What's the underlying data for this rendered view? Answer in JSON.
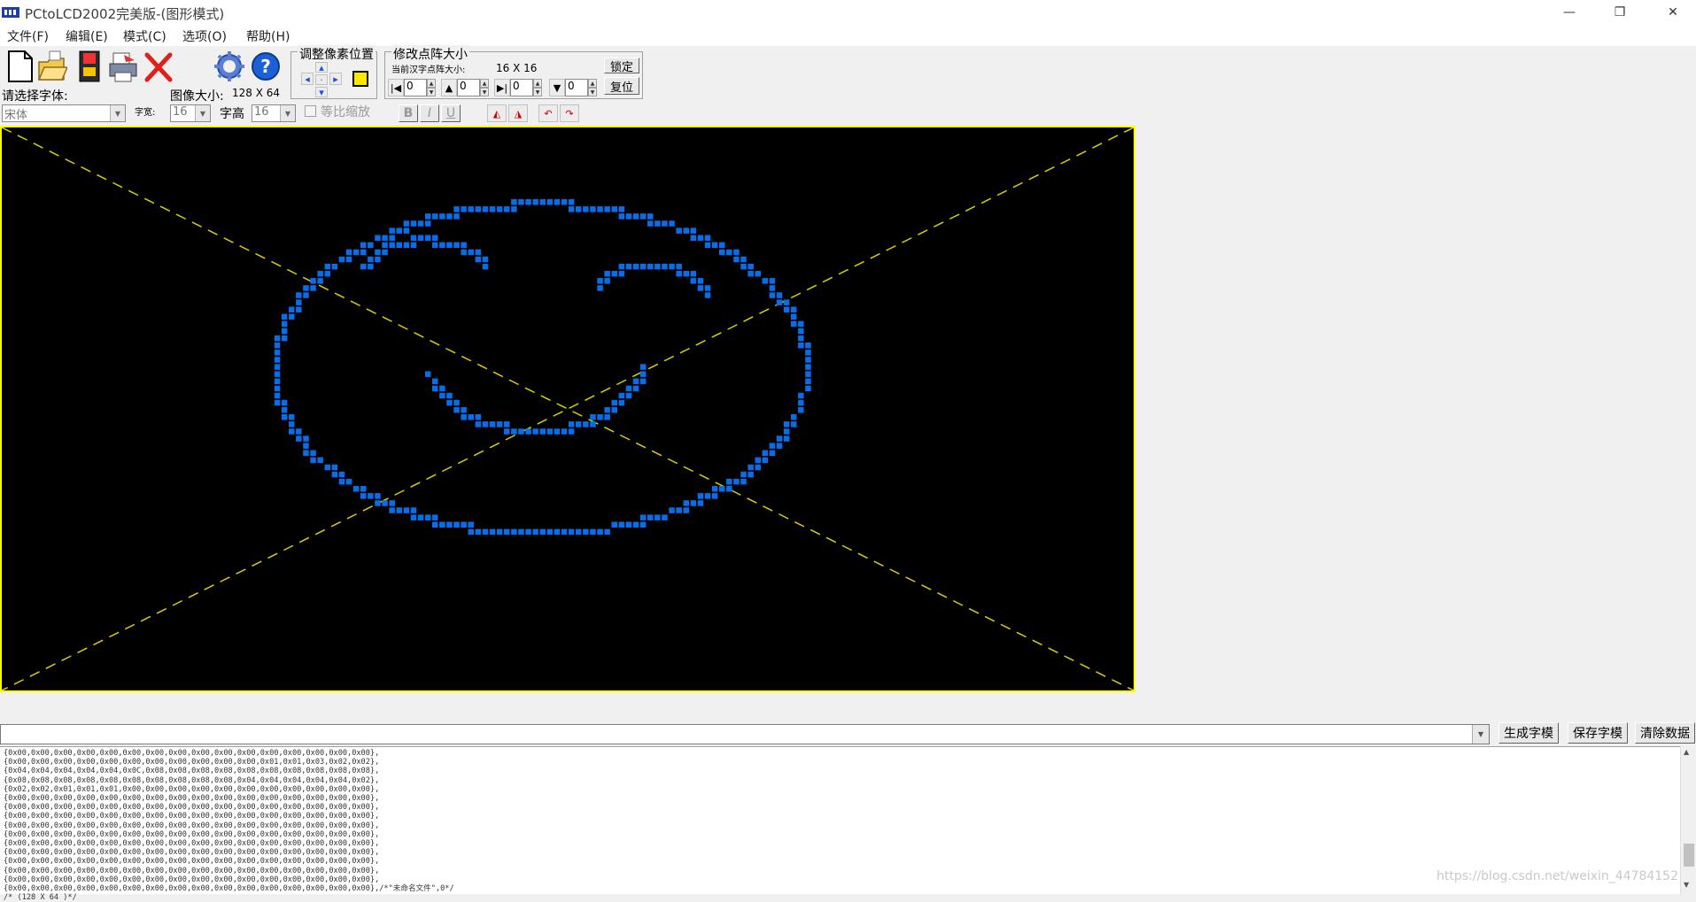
{
  "window": {
    "title": "PCtoLCD2002完美版-(图形模式)",
    "controls": [
      "—",
      "❐",
      "✕"
    ]
  },
  "menu": [
    "文件(F)",
    "编辑(E)",
    "模式(C)",
    "选项(O)",
    "帮助(H)"
  ],
  "toolbar": {
    "font_select_label": "请选择字体:",
    "font_value": "宋体",
    "char_width_label": "字宽:",
    "char_width_value": "16",
    "image_size_label": "图像大小:",
    "image_size_value": "128 X 64",
    "char_height_label": "字高",
    "char_height_value": "16",
    "proportional_label": "等比缩放",
    "style_buttons": [
      "B",
      "I",
      "U"
    ],
    "adjust_pixel_label": "调整像素位置",
    "modify_matrix_label": "修改点阵大小",
    "current_matrix_label": "当前汉字点阵大小:",
    "current_matrix_value": "16 X 16",
    "spin_values": [
      "0",
      "0",
      "0",
      "0"
    ],
    "lock_label": "锁定",
    "reset_label": "复位"
  },
  "bottom": {
    "input_value": "",
    "generate_label": "生成字模",
    "save_label": "保存字模",
    "clear_label": "清除数据"
  },
  "output_lines": [
    "{0x00,0x00,0x00,0x00,0x00,0x00,0x00,0x00,0x00,0x00,0x00,0x00,0x00,0x00,0x00,0x00},",
    "{0x00,0x00,0x00,0x00,0x00,0x00,0x00,0x00,0x00,0x00,0x00,0x01,0x01,0x03,0x02,0x02},",
    "{0x04,0x04,0x04,0x04,0x04,0x0C,0x08,0x08,0x08,0x08,0x08,0x08,0x08,0x08,0x08,0x08},",
    "{0x08,0x08,0x08,0x08,0x08,0x08,0x08,0x08,0x08,0x08,0x04,0x04,0x04,0x04,0x04,0x02},",
    "{0x02,0x02,0x01,0x01,0x01,0x00,0x00,0x00,0x00,0x00,0x00,0x00,0x00,0x00,0x00,0x00},",
    "{0x00,0x00,0x00,0x00,0x00,0x00,0x00,0x00,0x00,0x00,0x00,0x00,0x00,0x00,0x00,0x00},",
    "{0x00,0x00,0x00,0x00,0x00,0x00,0x00,0x00,0x00,0x00,0x00,0x00,0x00,0x00,0x00,0x00},",
    "{0x00,0x00,0x00,0x00,0x00,0x00,0x00,0x00,0x00,0x00,0x00,0x00,0x00,0x00,0x00,0x00},",
    "{0x00,0x00,0x00,0x00,0x00,0x00,0x00,0x00,0x00,0x00,0x00,0x00,0x00,0x00,0x00,0x00},",
    "{0x00,0x00,0x00,0x00,0x00,0x00,0x00,0x00,0x00,0x00,0x00,0x00,0x00,0x00,0x00,0x00},",
    "{0x00,0x00,0x00,0x00,0x00,0x00,0x00,0x00,0x00,0x00,0x00,0x00,0x00,0x00,0x00,0x00},",
    "{0x00,0x00,0x00,0x00,0x00,0x00,0x00,0x00,0x00,0x00,0x00,0x00,0x00,0x00,0x00,0x00},",
    "{0x00,0x00,0x00,0x00,0x00,0x00,0x00,0x00,0x00,0x00,0x00,0x00,0x00,0x00,0x00,0x00},",
    "{0x00,0x00,0x00,0x00,0x00,0x00,0x00,0x00,0x00,0x00,0x00,0x00,0x00,0x00,0x00,0x00},",
    "{0x00,0x00,0x00,0x00,0x00,0x00,0x00,0x00,0x00,0x00,0x00,0x00,0x00,0x00,0x00,0x00},",
    "{0x00,0x00,0x00,0x00,0x00,0x00,0x00,0x00,0x00,0x00,0x00,0x00,0x00,0x00,0x00,0x00},/*\"未命名文件\",0*/",
    "/* (128 X 64 )*/"
  ],
  "watermark": "https://blog.csdn.net/weixin_44784152",
  "colors": {
    "pixel": "#0a6de8",
    "grid_line": "#d8d000",
    "canvas_bg": "#000000",
    "canvas_border": "#ffff00"
  }
}
